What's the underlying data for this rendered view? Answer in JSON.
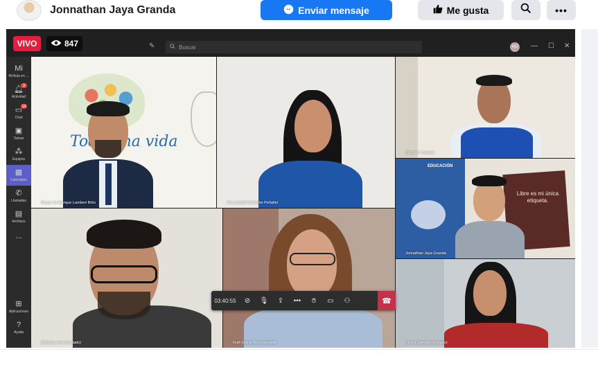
{
  "profile": {
    "name": "Jonnathan Jaya Granda",
    "send_message": "Enviar mensaje",
    "like": "Me gusta",
    "more": "•••"
  },
  "stream": {
    "live_label": "VIVO",
    "viewers": "847"
  },
  "teams": {
    "search_placeholder": "Buscar",
    "avatar_initials": "MJ",
    "rail": [
      {
        "label": "Mi Aula en ...",
        "icon": "teams-icon"
      },
      {
        "label": "Actividad",
        "icon": "bell-icon",
        "badge": "3"
      },
      {
        "label": "Chat",
        "icon": "chat-icon",
        "badge": "14"
      },
      {
        "label": "Tareas",
        "icon": "tasks-icon"
      },
      {
        "label": "Equipos",
        "icon": "people-icon"
      },
      {
        "label": "Calendario",
        "icon": "calendar-icon"
      },
      {
        "label": "Llamadas",
        "icon": "phone-icon"
      },
      {
        "label": "Archivos",
        "icon": "file-icon"
      },
      {
        "label": "...",
        "icon": "more-icon"
      },
      {
        "label": "Aplicaciones",
        "icon": "apps-icon"
      },
      {
        "label": "Ayuda",
        "icon": "help-icon"
      }
    ],
    "participants": [
      {
        "name": "Roque de Enrique Lambert Brito"
      },
      {
        "name": "Irina Lizbeth Motoche Peñafiel"
      },
      {
        "name": "DMUMI / Gestión"
      },
      {
        "name": "Jonnathan Jaya Granda"
      },
      {
        "name": "Esteban Jena (Invitado)"
      },
      {
        "name": "Ruth Maria Mora Heredia"
      },
      {
        "name": "Vinent Jeimath (Invitado)"
      }
    ],
    "banner_text": "Toda una vida",
    "sign_text": "Libre es mi única etiqueta.",
    "poster_text": "EDUCACIÓN",
    "call_timer": "03:40:55"
  }
}
